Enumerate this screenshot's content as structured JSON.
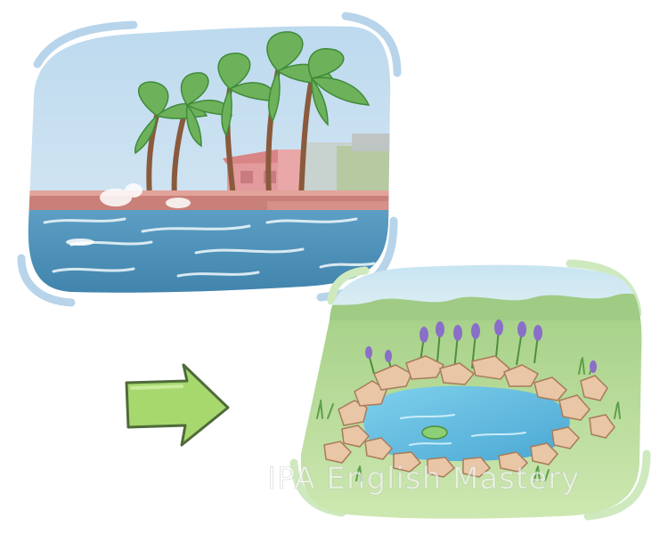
{
  "illustration": {
    "watermark_text": "IPA English Mastery",
    "palette": {
      "sky_top": "#cfe3f1",
      "sea": "#4a8fb6",
      "palm_leaf": "#6db25a",
      "house_pink": "#e39a9c",
      "grass": "#b9dc96",
      "pond_water": "#63bfe0",
      "rock": "#e8c6a6",
      "iris": "#8a6fc9",
      "arrow_fill": "#a6d86e",
      "frame_blue": "#b7d4ea",
      "frame_green": "#cfe9bf"
    }
  }
}
